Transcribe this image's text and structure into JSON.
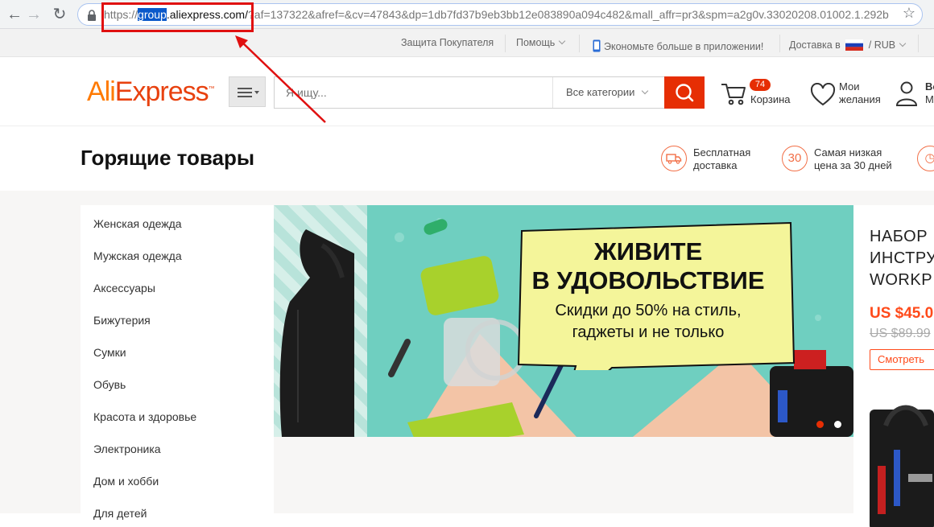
{
  "browser": {
    "url_scheme": "https://",
    "url_highlight": "group",
    "url_domain": ".aliexpress.com/",
    "url_rest": "?af=137322&afref=&cv=47843&dp=1db7fd37b9eb3bb12e083890a094c482&mall_affr=pr3&spm=a2g0v.33020208.01002.1.292b"
  },
  "topbar": {
    "protection": "Защита Покупателя",
    "help": "Помощь",
    "app": "Экономьте больше в приложении!",
    "delivery": "Доставка в",
    "currency": "RUB"
  },
  "header": {
    "logo_ali": "Ali",
    "logo_express": "Express",
    "search_placeholder": "Я ищу...",
    "category_select": "Все категории",
    "cart_count": "74",
    "cart_label": "Корзина",
    "wishlist_line1": "Мои",
    "wishlist_line2": "желания",
    "account_line1": "Во",
    "account_line2": "М"
  },
  "title_row": {
    "title": "Горящие товары",
    "feature1_line1": "Бесплатная",
    "feature1_line2": "доставка",
    "feature2_icon": "30",
    "feature2_line1": "Самая низкая",
    "feature2_line2": "цена за 30 дней"
  },
  "categories": [
    "Женская одежда",
    "Мужская одежда",
    "Аксессуары",
    "Бижутерия",
    "Сумки",
    "Обувь",
    "Красота и здоровье",
    "Электроника",
    "Дом и хобби",
    "Для детей"
  ],
  "banner": {
    "headline1": "ЖИВИТЕ",
    "headline2": "В УДОВОЛЬСТВИЕ",
    "sub1": "Скидки до 50% на стиль,",
    "sub2": "гаджеты и не только"
  },
  "promo": {
    "title": "НАБОР\nИНСТРУ\nWORKP",
    "price": "US $45.0",
    "old_price": "US $89.99",
    "button": "Смотреть"
  },
  "colors": {
    "accent": "#e62e04",
    "annotation": "#e01010",
    "banner_bg": "#6fcfc0",
    "bubble": "#f4f59a"
  },
  "icons": [
    "lock-icon",
    "star-icon",
    "search-icon",
    "cart-icon",
    "heart-icon",
    "user-icon",
    "menu-icon",
    "truck-icon",
    "phone-icon",
    "flag-ru-icon"
  ]
}
